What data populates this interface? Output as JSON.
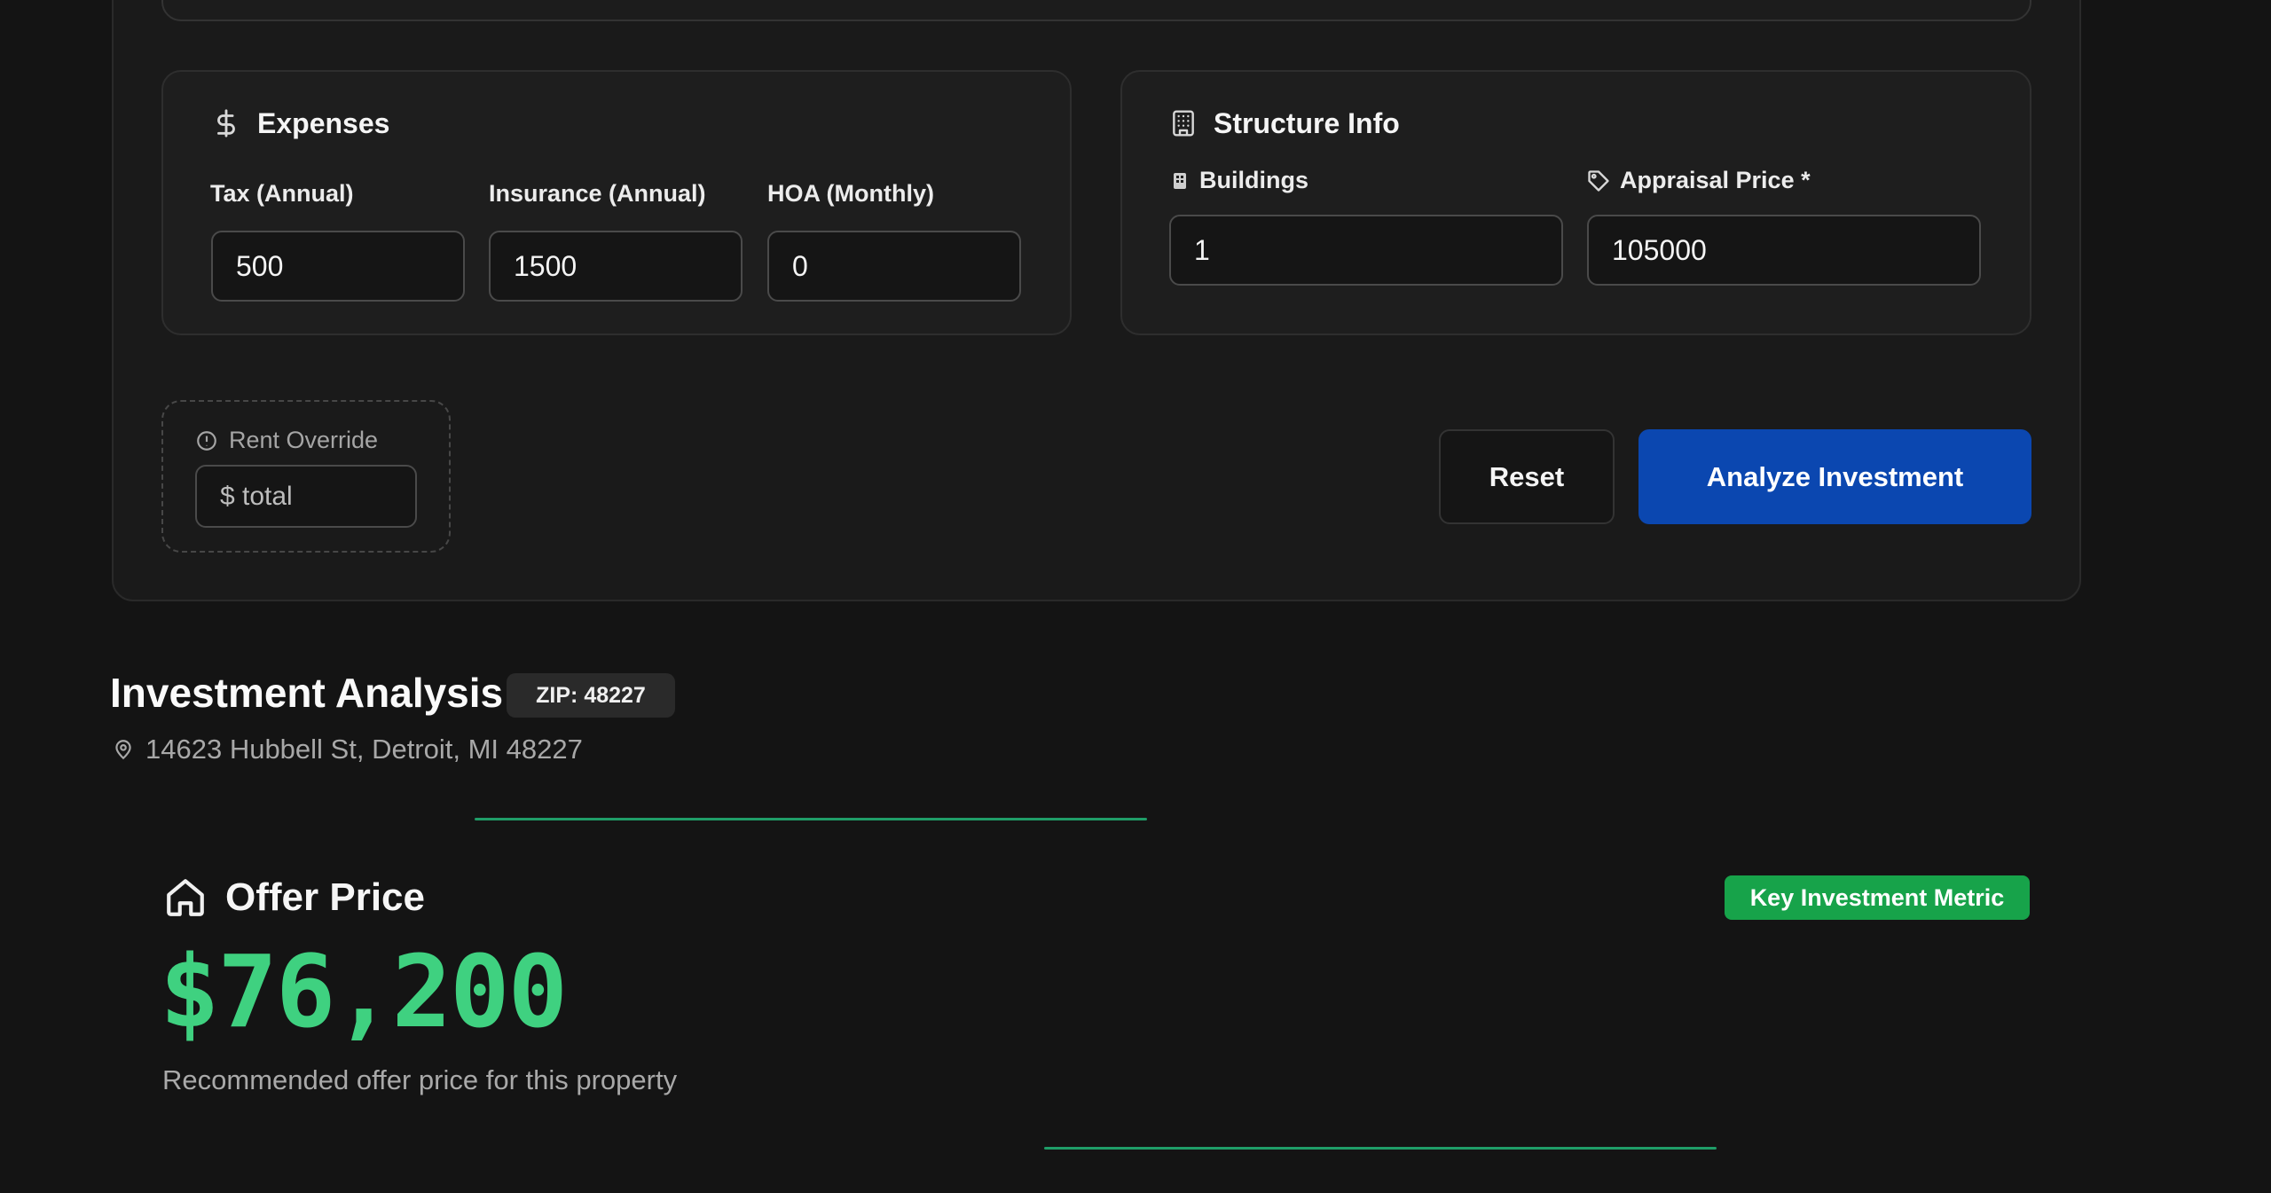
{
  "expenses": {
    "title": "Expenses",
    "icon": "dollar-icon",
    "fields": [
      {
        "label": "Tax (Annual)",
        "value": "500"
      },
      {
        "label": "Insurance (Annual)",
        "value": "1500"
      },
      {
        "label": "HOA (Monthly)",
        "value": "0"
      }
    ]
  },
  "structure": {
    "title": "Structure Info",
    "icon": "building-icon",
    "buildings": {
      "label": "Buildings",
      "value": "1"
    },
    "appraisal": {
      "label": "Appraisal Price *",
      "value": "105000"
    }
  },
  "rent_override": {
    "label": "Rent Override",
    "placeholder": "$ total"
  },
  "actions": {
    "reset": "Reset",
    "analyze": "Analyze Investment"
  },
  "analysis": {
    "title": "Investment Analysis",
    "zip_badge": "ZIP: 48227",
    "address": "14623 Hubbell St, Detroit, MI 48227",
    "offer": {
      "title": "Offer Price",
      "badge": "Key Investment Metric",
      "value": "$76,200",
      "description": "Recommended offer price for this property"
    }
  },
  "colors": {
    "background": "#141414",
    "card": "#1a1a1a",
    "primary_button": "#0b47b0",
    "accent_green": "#3fd180",
    "badge_green": "#17a34a"
  }
}
